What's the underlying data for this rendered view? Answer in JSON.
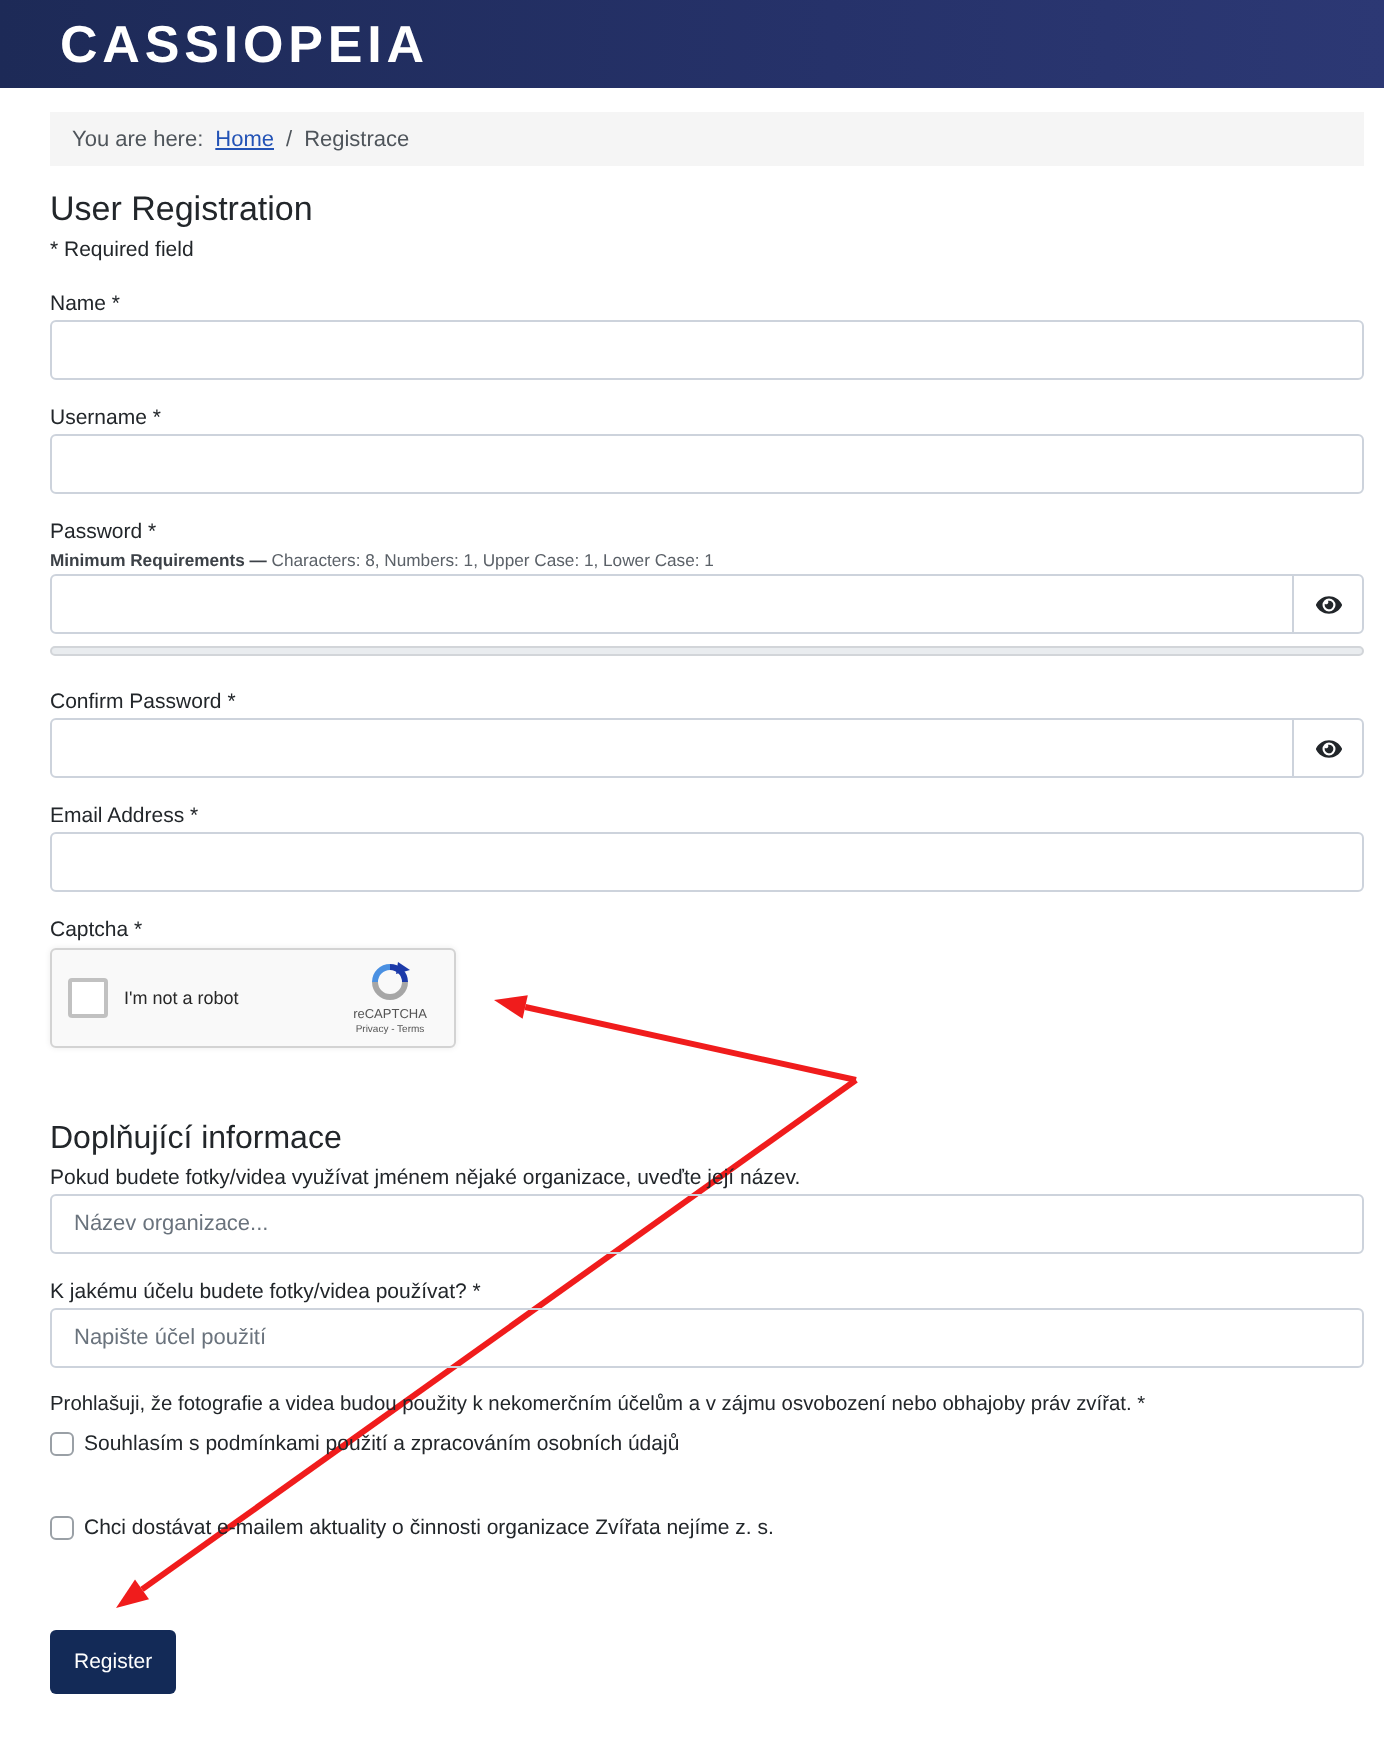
{
  "header": {
    "logo": "CASSIOPEIA"
  },
  "breadcrumb": {
    "prefix": "You are here:",
    "separator": "/",
    "items": [
      {
        "kind": "link",
        "label": "Home"
      },
      {
        "kind": "current",
        "label": "Registrace"
      }
    ]
  },
  "form": {
    "title": "User Registration",
    "required_note": "* Required field",
    "fields": [
      {
        "kind": "text",
        "label": "Name *"
      },
      {
        "kind": "text",
        "label": "Username *"
      },
      {
        "kind": "password",
        "label": "Password *",
        "hint": "**Minimum Requirements —** Characters: 8, Numbers: 1, Upper Case: 1, Lower Case: 1",
        "strength_meter": true
      },
      {
        "kind": "password",
        "label": "Confirm Password *"
      },
      {
        "kind": "text",
        "label": "Email Address *"
      },
      {
        "kind": "captcha",
        "label": "Captcha *",
        "captcha": {
          "checked": false,
          "text": "I'm not a robot",
          "brand": "reCAPTCHA",
          "links": "Privacy - Terms"
        }
      }
    ]
  },
  "extra": {
    "title": "Doplňující informace",
    "fields": [
      {
        "kind": "text",
        "label": "Pokud budete fotky/videa využívat jménem nějaké organizace, uveďte její název.",
        "placeholder": "Název organizace..."
      },
      {
        "kind": "text",
        "label": "K jakému účelu budete fotky/videa používat? *",
        "placeholder": "Napište účel použití"
      },
      {
        "kind": "statement",
        "label": "Prohlašuji, že fotografie a videa budou použity k nekomerčním účelům a v zájmu osvobození nebo obhajoby práv zvířat. *"
      },
      {
        "kind": "checkbox",
        "label": "Souhlasím s podmínkami použití a zpracováním osobních údajů",
        "checked": false
      },
      {
        "kind": "checkbox",
        "label": "Chci dostávat e-mailem aktuality o činnosti organizace Zvířata nejíme z. s.",
        "checked": false
      }
    ]
  },
  "submit": {
    "label": "Register"
  }
}
